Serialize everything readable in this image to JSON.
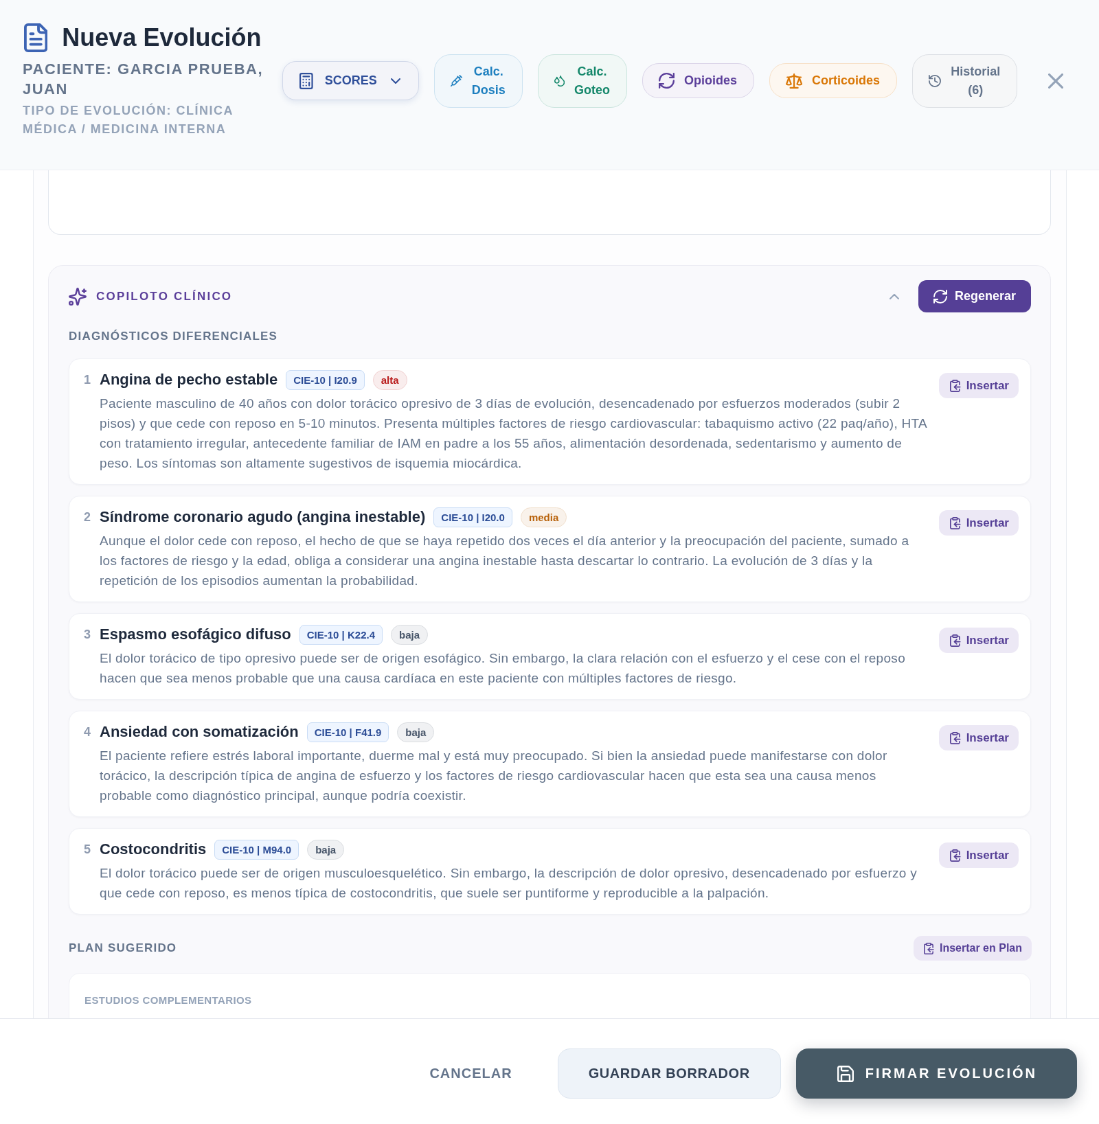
{
  "header": {
    "title": "Nueva Evolución",
    "patient": "PACIENTE: GARCIA PRUEBA, JUAN",
    "evolution_type": "TIPO DE EVOLUCIÓN: CLÍNICA MÉDICA / MEDICINA INTERNA"
  },
  "toolbar": [
    {
      "kind": "dropdown",
      "label": "SCORES",
      "color": "#2f4f9a"
    },
    {
      "kind": "button",
      "label": "Calc. Dosis",
      "color": "#1d7fbf"
    },
    {
      "kind": "button",
      "label": "Calc. Goteo",
      "color": "#13876a"
    },
    {
      "kind": "button",
      "label": "Opioides",
      "color": "#5b3f9a"
    },
    {
      "kind": "button",
      "label": "Corticoides",
      "color": "#d97706"
    },
    {
      "kind": "button",
      "label": "Historial (6)",
      "color": "#64748b"
    }
  ],
  "copilot": {
    "title": "COPILOTO CLÍNICO",
    "expanded": true,
    "regenerate_label": "Regenerar",
    "differentials": {
      "title": "DIAGNÓSTICOS DIFERENCIALES",
      "items": [
        {
          "number": "1",
          "name": "Angina de pecho estable",
          "code": "CIE-10 | I20.9",
          "likelihood": {
            "label": "alta",
            "color": "#b91c1c"
          },
          "description": "Paciente masculino de 40 años con dolor torácico opresivo de 3 días de evolución, desencadenado por esfuerzos moderados (subir 2 pisos) y que cede con reposo en 5-10 minutos. Presenta múltiples factores de riesgo cardiovascular: tabaquismo activo (22 paq/año), HTA con tratamiento irregular, antecedente familiar de IAM en padre a los 55 años, alimentación desordenada, sedentarismo y aumento de peso. Los síntomas son altamente sugestivos de isquemia miocárdica.",
          "action": "Insertar"
        },
        {
          "number": "2",
          "name": "Síndrome coronario agudo (angina inestable)",
          "code": "CIE-10 | I20.0",
          "likelihood": {
            "label": "media",
            "color": "#b8620b"
          },
          "description": "Aunque el dolor cede con reposo, el hecho de que se haya repetido dos veces el día anterior y la preocupación del paciente, sumado a los factores de riesgo y la edad, obliga a considerar una angina inestable hasta descartar lo contrario. La evolución de 3 días y la repetición de los episodios aumentan la probabilidad.",
          "action": "Insertar"
        },
        {
          "number": "3",
          "name": "Espasmo esofágico difuso",
          "code": "CIE-10 | K22.4",
          "likelihood": {
            "label": "baja",
            "color": "#475569"
          },
          "description": "El dolor torácico de tipo opresivo puede ser de origen esofágico. Sin embargo, la clara relación con el esfuerzo y el cese con el reposo hacen que sea menos probable que una causa cardíaca en este paciente con múltiples factores de riesgo.",
          "action": "Insertar"
        },
        {
          "number": "4",
          "name": "Ansiedad con somatización",
          "code": "CIE-10 | F41.9",
          "likelihood": {
            "label": "baja",
            "color": "#475569"
          },
          "description": "El paciente refiere estrés laboral importante, duerme mal y está muy preocupado. Si bien la ansiedad puede manifestarse con dolor torácico, la descripción típica de angina de esfuerzo y los factores de riesgo cardiovascular hacen que esta sea una causa menos probable como diagnóstico principal, aunque podría coexistir.",
          "action": "Insertar"
        },
        {
          "number": "5",
          "name": "Costocondritis",
          "code": "CIE-10 | M94.0",
          "likelihood": {
            "label": "baja",
            "color": "#475569"
          },
          "description": "El dolor torácico puede ser de origen musculoesquelético. Sin embargo, la descripción de dolor opresivo, desencadenado por esfuerzo y que cede con reposo, es menos típica de costocondritis, que suele ser puntiforme y reproducible a la palpación.",
          "action": "Insertar"
        }
      ]
    },
    "plan": {
      "title": "PLAN SUGERIDO",
      "action": "Insertar en Plan",
      "sections": [
        {
          "title": "ESTUDIOS COMPLEMENTARIOS"
        }
      ]
    }
  },
  "footer": {
    "buttons": [
      {
        "kind": "text",
        "label": "CANCELAR"
      },
      {
        "kind": "secondary",
        "label": "GUARDAR BORRADOR"
      },
      {
        "kind": "primary",
        "label": "FIRMAR EVOLUCIÓN"
      }
    ]
  }
}
